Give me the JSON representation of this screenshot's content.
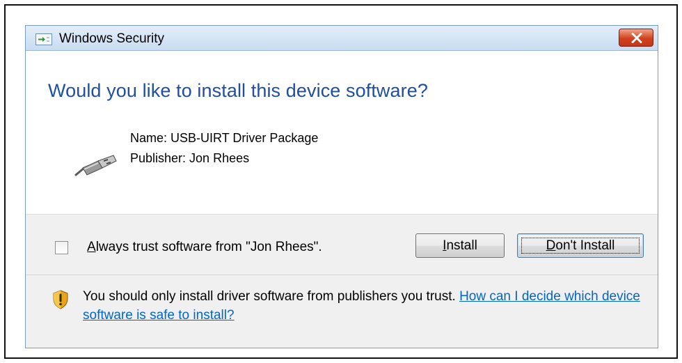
{
  "window": {
    "title": "Windows Security",
    "close_symbol": "✕"
  },
  "prompt": {
    "heading": "Would you like to install this device software?",
    "name_line": "Name: USB-UIRT Driver Package",
    "publisher_line": "Publisher: Jon Rhees"
  },
  "trust_option": {
    "accel": "A",
    "label_rest": "lways trust software from \"Jon Rhees\".",
    "checked": false
  },
  "buttons": {
    "install_accel": "I",
    "install_rest": "nstall",
    "dont_install_accel": "D",
    "dont_install_rest": "on't Install"
  },
  "warning": {
    "text": "You should only install driver software from publishers you trust. ",
    "link": "How can I decide which device software is safe to install?"
  },
  "icons": {
    "app": "install-arrow-icon",
    "device": "usb-plug-icon",
    "warning": "shield-warning-icon"
  },
  "colors": {
    "heading": "#1f4ea3",
    "link": "#0066cc",
    "close_button": "#c9401c"
  }
}
